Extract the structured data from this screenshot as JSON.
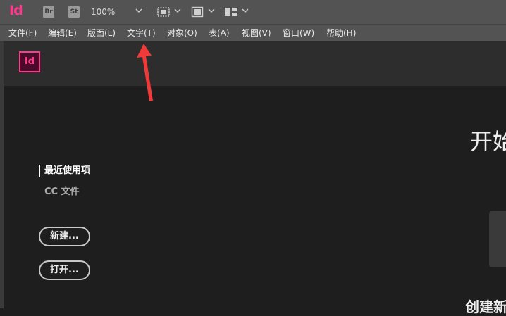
{
  "app": {
    "logo": "Id",
    "bridge_label": "Br",
    "stock_label": "St",
    "zoom": "100%"
  },
  "menu": [
    {
      "label": "文件(F)"
    },
    {
      "label": "编辑(E)"
    },
    {
      "label": "版面(L)"
    },
    {
      "label": "文字(T)"
    },
    {
      "label": "对象(O)"
    },
    {
      "label": "表(A)"
    },
    {
      "label": "视图(V)"
    },
    {
      "label": "窗口(W)"
    },
    {
      "label": "帮助(H)"
    }
  ],
  "home": {
    "logo": "Id",
    "nav_recent": "最近使用项",
    "nav_cc": "CC 文件",
    "new_button": "新建...",
    "open_button": "打开...",
    "welcome_title": "开始",
    "create_new": "创建新"
  },
  "colors": {
    "accent": "#ff3a8c",
    "annotation": "#f03a3a"
  }
}
